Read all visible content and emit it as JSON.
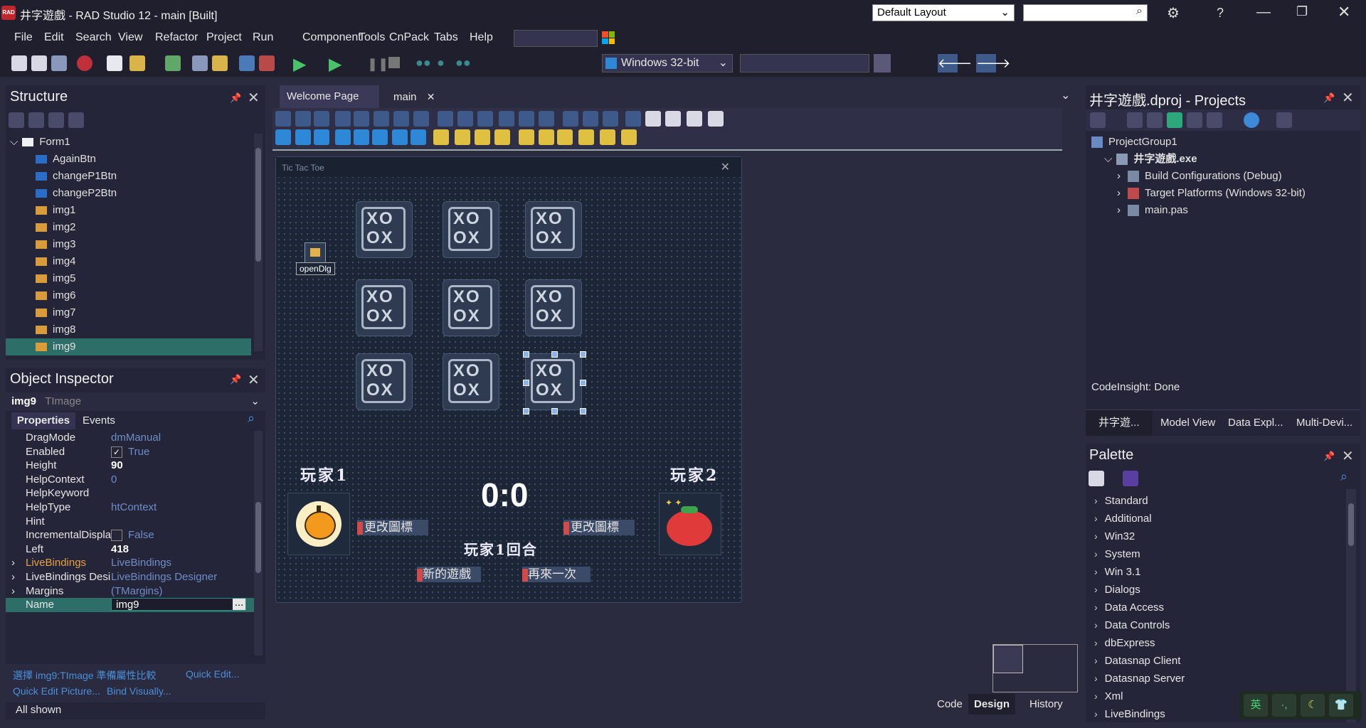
{
  "window": {
    "app_badge": "RAD",
    "title": "井字遊戲 - RAD Studio 12 - main [Built]",
    "layout_select": "Default Layout"
  },
  "menu": [
    "File",
    "Edit",
    "Search",
    "View",
    "Refactor",
    "Project",
    "Run",
    "Component",
    "Tools",
    "CnPack",
    "Tabs",
    "Help"
  ],
  "toolbar": {
    "platform": "Windows 32-bit"
  },
  "structure": {
    "title": "Structure",
    "items": [
      {
        "label": "Form1",
        "type": "form"
      },
      {
        "label": "AgainBtn",
        "type": "button"
      },
      {
        "label": "changeP1Btn",
        "type": "button"
      },
      {
        "label": "changeP2Btn",
        "type": "button"
      },
      {
        "label": "img1",
        "type": "image"
      },
      {
        "label": "img2",
        "type": "image"
      },
      {
        "label": "img3",
        "type": "image"
      },
      {
        "label": "img4",
        "type": "image"
      },
      {
        "label": "img5",
        "type": "image"
      },
      {
        "label": "img6",
        "type": "image"
      },
      {
        "label": "img7",
        "type": "image"
      },
      {
        "label": "img8",
        "type": "image"
      },
      {
        "label": "img9",
        "type": "image",
        "selected": true
      }
    ]
  },
  "inspector": {
    "title": "Object Inspector",
    "object_name": "img9",
    "object_type": "TImage",
    "tab_properties": "Properties",
    "tab_events": "Events",
    "rows": [
      {
        "name": "DragMode",
        "value": "dmManual"
      },
      {
        "name": "Enabled",
        "value": "True",
        "check": true
      },
      {
        "name": "Height",
        "value": "90",
        "bold": true
      },
      {
        "name": "HelpContext",
        "value": "0"
      },
      {
        "name": "HelpKeyword",
        "value": ""
      },
      {
        "name": "HelpType",
        "value": "htContext"
      },
      {
        "name": "Hint",
        "value": ""
      },
      {
        "name": "IncrementalDispla",
        "value": "False",
        "check": false
      },
      {
        "name": "Left",
        "value": "418",
        "bold": true
      },
      {
        "name": "LiveBindings",
        "value": "LiveBindings",
        "expand": true,
        "orange": true
      },
      {
        "name": "LiveBindings Desi",
        "value": "LiveBindings Designer",
        "expand": true
      },
      {
        "name": "Margins",
        "value": "(TMargins)",
        "expand": true
      },
      {
        "name": "Name",
        "value": "img9",
        "editing": true
      }
    ],
    "hint_line1a": "選擇 img9:TImage 準備屬性比較",
    "hint_line1b": "Quick Edit...",
    "hint_line2a": "Quick Edit Picture...",
    "hint_line2b": "Bind Visually...",
    "status": "All shown"
  },
  "editor": {
    "tabs": [
      {
        "label": "Welcome Page"
      },
      {
        "label": "main",
        "active": true
      }
    ],
    "form_caption": "Tic Tac Toe",
    "opendlg_label": "openDlg",
    "player1": "玩家1",
    "player2": "玩家2",
    "score": "0:0",
    "change_icon_1": "更改圖標",
    "change_icon_2": "更改圖標",
    "turn_label": "玩家1回合",
    "new_game": "新的遊戲",
    "again": "再來一次",
    "bottom_tabs": [
      "Code",
      "Design",
      "History"
    ]
  },
  "projects": {
    "title": "井字遊戲.dproj - Projects",
    "items": [
      {
        "label": "ProjectGroup1",
        "level": 0
      },
      {
        "label": "井字遊戲.exe",
        "level": 1,
        "bold": true
      },
      {
        "label": "Build Configurations (Debug)",
        "level": 2
      },
      {
        "label": "Target Platforms (Windows 32-bit)",
        "level": 2
      },
      {
        "label": "main.pas",
        "level": 2
      }
    ],
    "status": "CodeInsight: Done",
    "tabs": [
      "井字遊...",
      "Model View",
      "Data Expl...",
      "Multi-Devi..."
    ]
  },
  "palette": {
    "title": "Palette",
    "items": [
      "Standard",
      "Additional",
      "Win32",
      "System",
      "Win 3.1",
      "Dialogs",
      "Data Access",
      "Data Controls",
      "dbExpress",
      "Datasnap Client",
      "Datasnap Server",
      "Xml",
      "LiveBindings"
    ]
  },
  "ime": {
    "lang": "英"
  },
  "colors": {
    "accent": "#2b7a78",
    "selected_row": "#2d6e69",
    "panel_bg": "#252539",
    "form_bg": "#1c2637"
  }
}
